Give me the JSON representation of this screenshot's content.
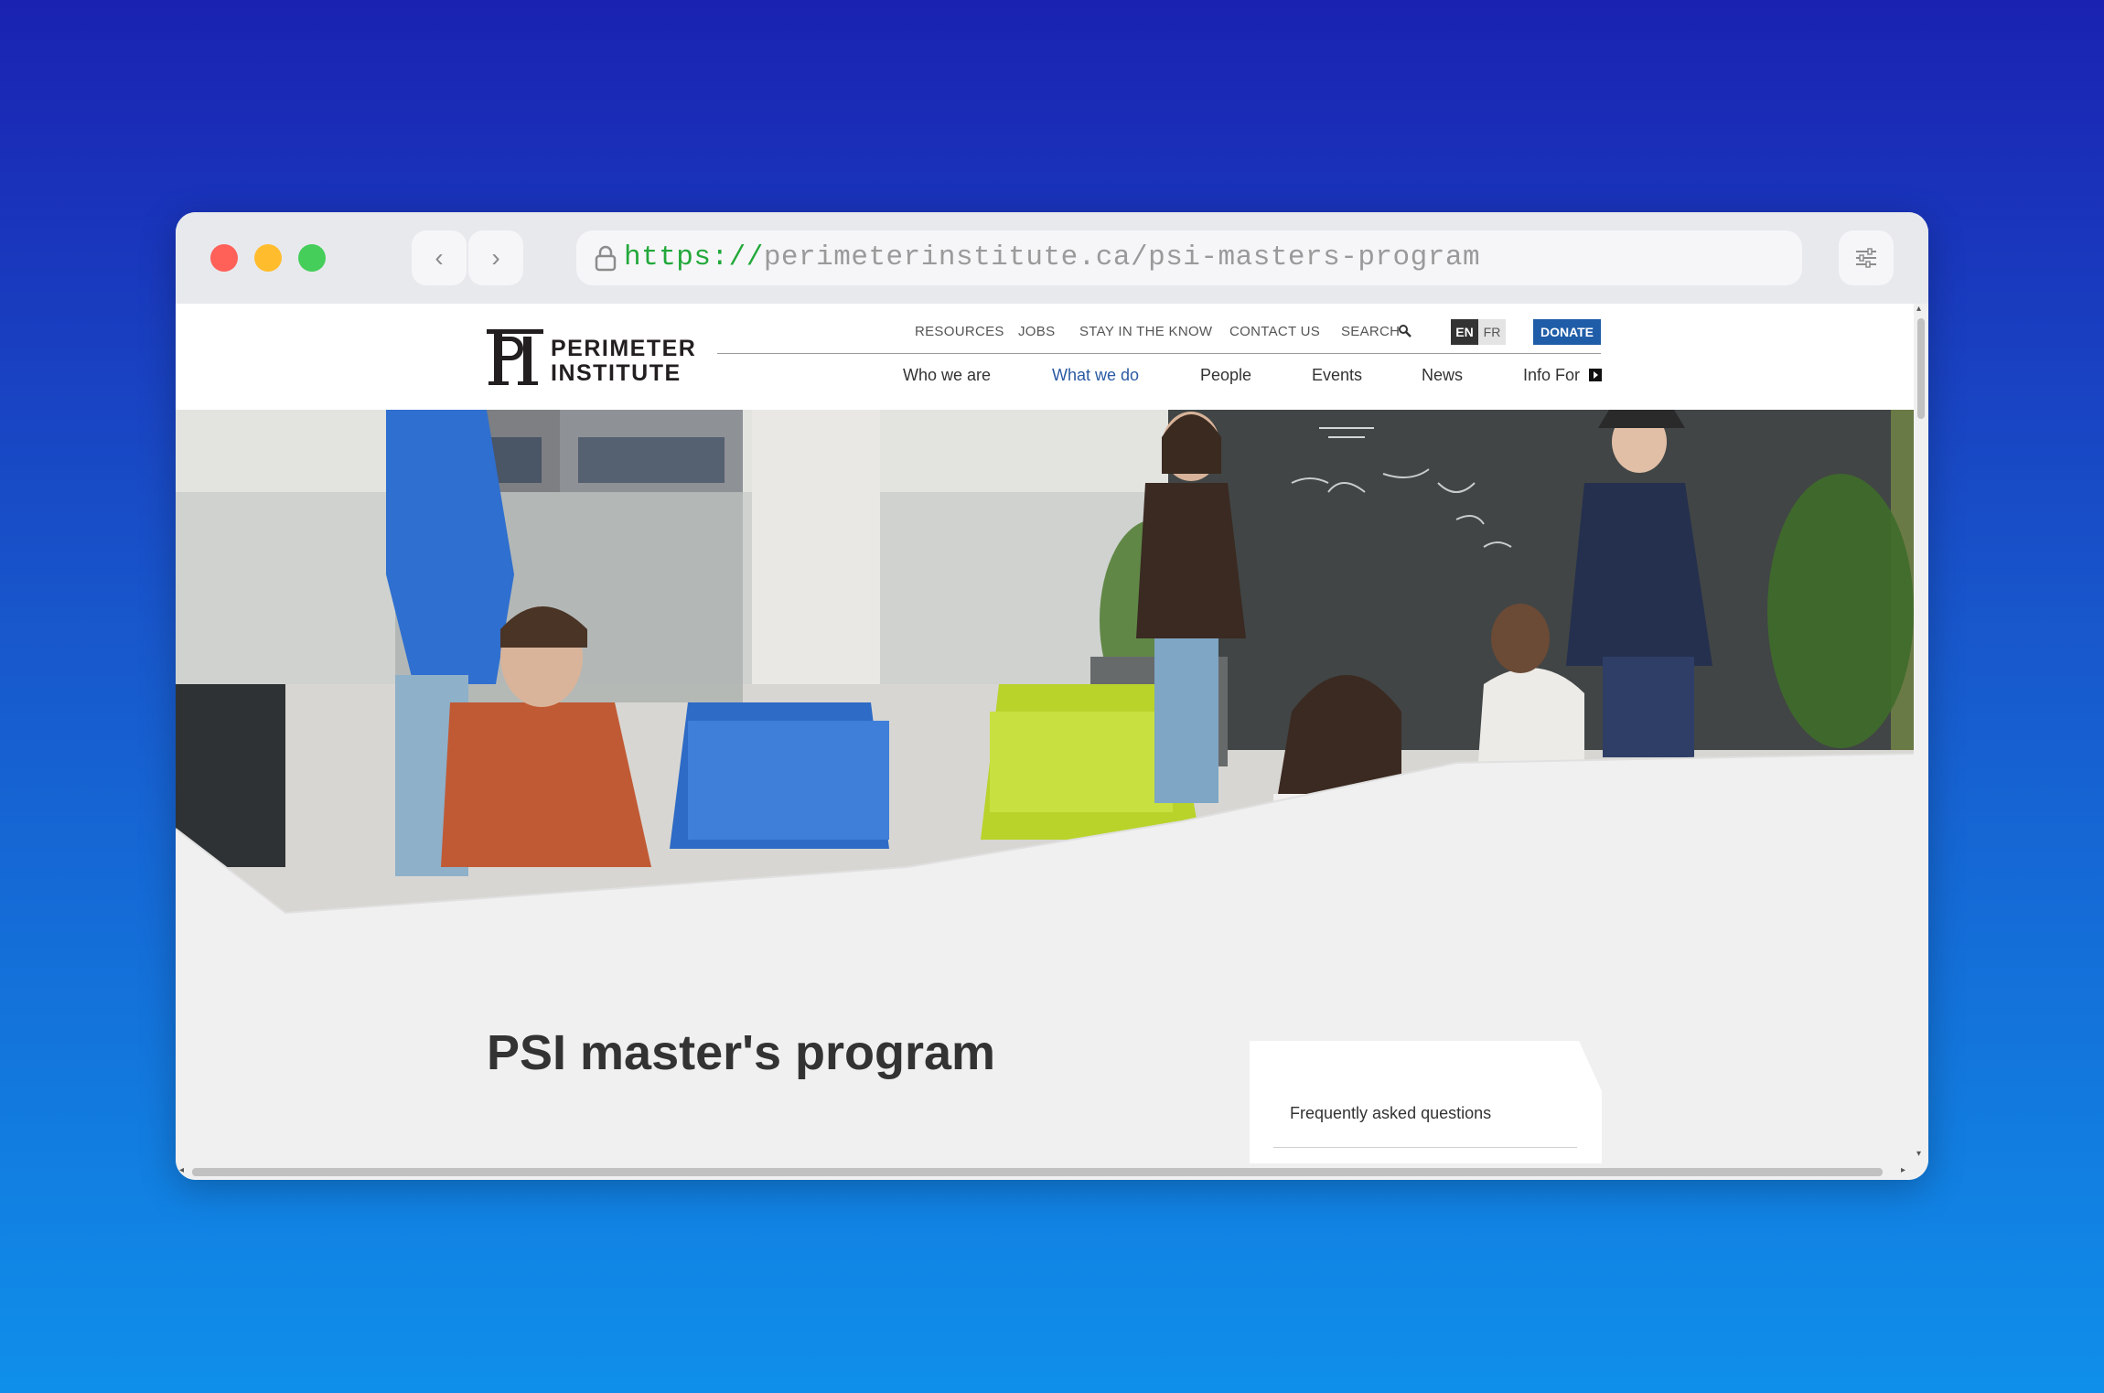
{
  "browser": {
    "url_scheme": "https://",
    "url_rest": "perimeterinstitute.ca/psi-masters-program",
    "back_glyph": "‹",
    "forward_glyph": "›"
  },
  "logo": {
    "monogram": "PI",
    "line1": "PERIMETER",
    "line2": "INSTITUTE"
  },
  "utility_nav": {
    "resources": "RESOURCES",
    "jobs": "JOBS",
    "stay": "STAY IN THE KNOW",
    "contact": "CONTACT US",
    "search": "SEARCH",
    "lang_en": "EN",
    "lang_fr": "FR",
    "donate": "DONATE"
  },
  "main_nav": {
    "who": "Who we are",
    "what": "What we do",
    "people": "People",
    "events": "Events",
    "news": "News",
    "info": "Info For"
  },
  "page": {
    "title": "PSI master's program",
    "faq_link": "Frequently asked questions"
  },
  "colors": {
    "brand_blue": "#1f5da8",
    "active_nav": "#2a5aa3",
    "page_bg": "#f0f0f0"
  },
  "icons": [
    "lock-icon",
    "search-icon",
    "settings-icon",
    "external-arrow-icon"
  ]
}
